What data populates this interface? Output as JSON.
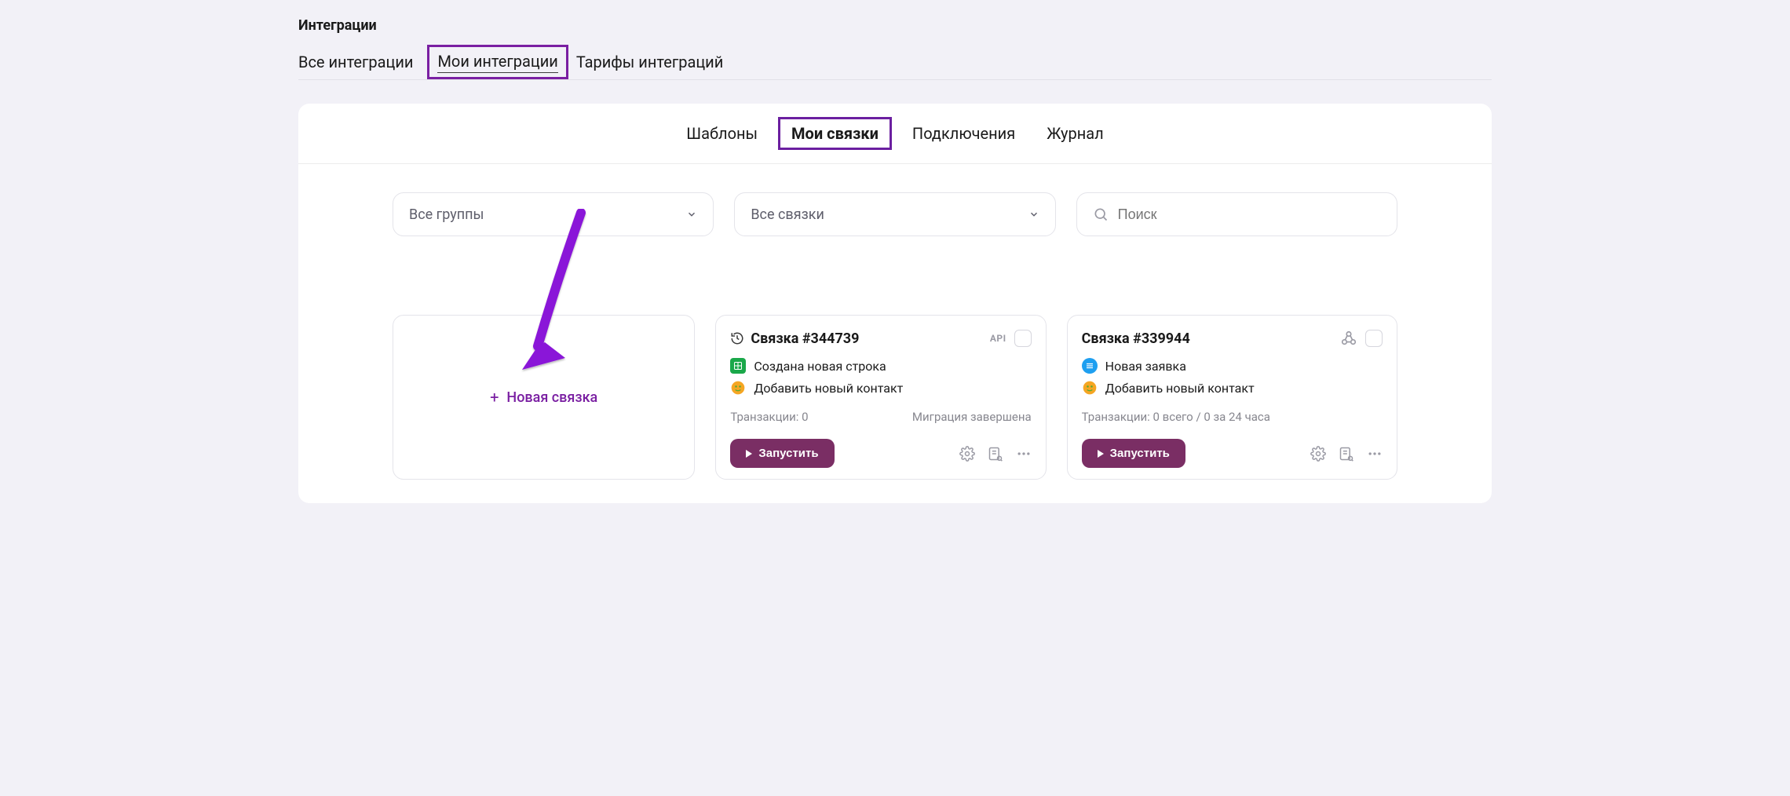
{
  "colors": {
    "accent": "#7a1fa2",
    "runButton": "#7a2e64"
  },
  "page_title": "Интеграции",
  "top_tabs": [
    {
      "label": "Все интеграции"
    },
    {
      "label": "Мои интеграции",
      "highlighted": true
    },
    {
      "label": "Тарифы интеграций"
    }
  ],
  "inner_tabs": [
    {
      "label": "Шаблоны"
    },
    {
      "label": "Мои связки",
      "active": true
    },
    {
      "label": "Подключения"
    },
    {
      "label": "Журнал"
    }
  ],
  "filters": {
    "groups_label": "Все группы",
    "links_label": "Все связки",
    "search_placeholder": "Поиск"
  },
  "new_card": {
    "label": "Новая связка"
  },
  "cards": [
    {
      "title": "Связка #344739",
      "badge": "API",
      "has_webhook_icon": false,
      "line1_icon": "sheets-icon",
      "line1_text": "Создана новая строка",
      "line2_icon": "contact-icon",
      "line2_text": "Добавить новый контакт",
      "stats_left": "Транзакции: 0",
      "stats_right": "Миграция завершена",
      "run_label": "Запустить"
    },
    {
      "title": "Связка #339944",
      "badge": "",
      "has_webhook_icon": true,
      "line1_icon": "request-icon",
      "line1_text": "Новая заявка",
      "line2_icon": "contact-icon",
      "line2_text": "Добавить новый контакт",
      "stats_left": "Транзакции: 0 всего / 0 за 24 часа",
      "stats_right": "",
      "run_label": "Запустить"
    }
  ]
}
